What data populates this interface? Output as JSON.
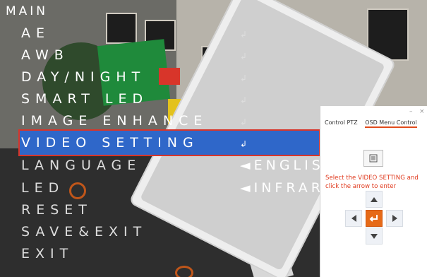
{
  "osd": {
    "title": "MAIN",
    "items": [
      {
        "label": "AE",
        "value": "",
        "enter": "↲"
      },
      {
        "label": "AWB",
        "value": "",
        "enter": "↲"
      },
      {
        "label": "DAY/NIGHT",
        "value": "",
        "enter": "↲"
      },
      {
        "label": "SMART LED",
        "value": "",
        "enter": "↲"
      },
      {
        "label": "IMAGE ENHANCE",
        "value": "",
        "enter": "↲"
      },
      {
        "label": "VIDEO SETTING",
        "value": "",
        "enter": "↲"
      },
      {
        "label": "LANGUAGE",
        "value": "◄ENGLIS",
        "enter": ""
      },
      {
        "label": "LED",
        "value": "◄INFRAR",
        "enter": ""
      },
      {
        "label": "RESET",
        "value": "",
        "enter": ""
      },
      {
        "label": "SAVE&EXIT",
        "value": "",
        "enter": ""
      },
      {
        "label": "EXIT",
        "value": "",
        "enter": ""
      }
    ],
    "selected": "VIDEO SETTING"
  },
  "control": {
    "tabs": [
      "Control PTZ",
      "OSD Menu Control"
    ],
    "active_tab": "OSD Menu Control",
    "window_buttons": [
      "–",
      "×"
    ],
    "hint": "Select the VIDEO SETTING  and click the arrow to enter",
    "icons": [
      "menu-icon",
      "arrow-up-icon",
      "arrow-left-icon",
      "enter-icon",
      "arrow-right-icon",
      "arrow-down-icon"
    ]
  },
  "colors": {
    "highlight": "#2f67c9",
    "highlight_border": "#d8352a",
    "hint_text": "#e03a1e",
    "enter_button": "#e66a18"
  }
}
